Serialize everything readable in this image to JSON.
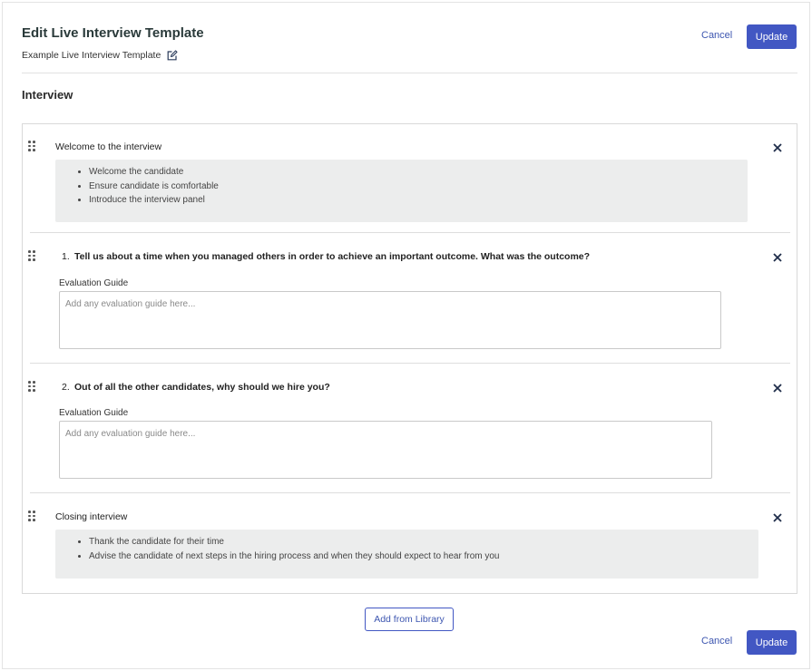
{
  "header": {
    "title": "Edit Live Interview Template",
    "template_name": "Example Live Interview Template",
    "edit_icon": "pencil-square-icon",
    "cancel_label": "Cancel",
    "update_label": "Update"
  },
  "section": {
    "heading": "Interview"
  },
  "items": [
    {
      "kind": "note",
      "title": "Welcome to the interview",
      "bullets": [
        "Welcome the candidate",
        "Ensure candidate is comfortable",
        "Introduce the interview panel"
      ]
    },
    {
      "kind": "question",
      "number": "1.",
      "text": "Tell us about a time when you managed others in order to achieve an important outcome. What was the outcome?",
      "eval_label": "Evaluation Guide",
      "eval_placeholder": "Add any evaluation guide here..."
    },
    {
      "kind": "question",
      "number": "2.",
      "text": "Out of all the other candidates, why should we hire you?",
      "eval_label": "Evaluation Guide",
      "eval_placeholder": "Add any evaluation guide here..."
    },
    {
      "kind": "note",
      "title": "Closing interview",
      "bullets": [
        "Thank the candidate for their time",
        "Advise the candidate of next steps in the hiring process and when they should expect to hear from you"
      ]
    }
  ],
  "footer": {
    "add_library_label": "Add from Library",
    "cancel_label": "Cancel",
    "update_label": "Update"
  },
  "colors": {
    "accent": "#4257c3",
    "link": "#3d56b0",
    "note_bg": "#eceded"
  }
}
